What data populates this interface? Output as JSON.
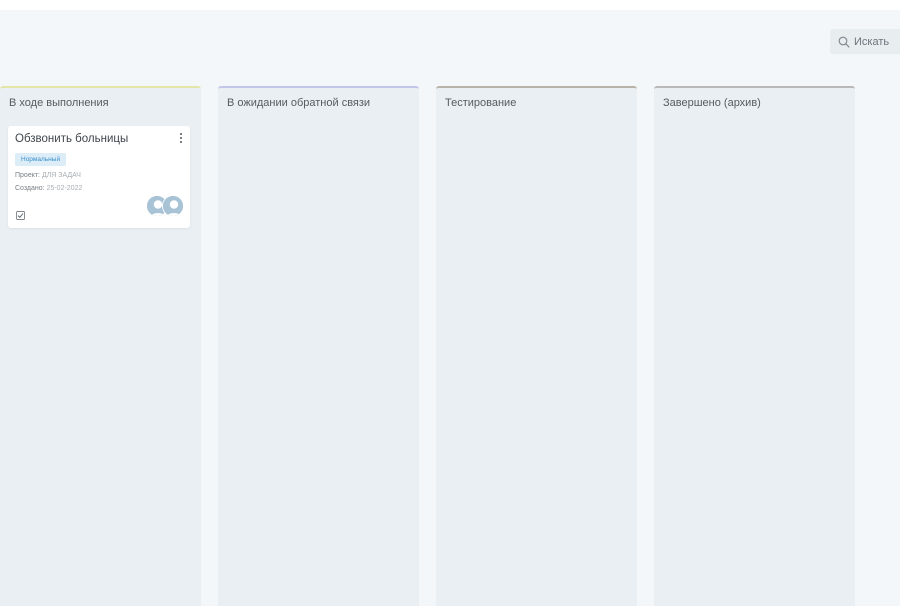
{
  "search": {
    "label": "Искать",
    "icon": "search-icon"
  },
  "columns": [
    {
      "title": "В ходе выполнения",
      "accent": "#e3e6a8",
      "cards": [
        {
          "title": "Обзвонить больницы",
          "priority": "Нормальный",
          "project_label": "Проект:",
          "project_value": "ДЛЯ ЗАДАЧ",
          "created_label": "Создано:",
          "created_value": "25-02-2022",
          "icons": [
            "checklist-icon",
            "more-vertical-icon"
          ],
          "avatars": 2
        }
      ]
    },
    {
      "title": "В ожидании обратной связи",
      "accent": "#c2c6e8",
      "cards": []
    },
    {
      "title": "Тестирование",
      "accent": "#b7b3a8",
      "cards": []
    },
    {
      "title": "Завершено (архив)",
      "accent": "#b9b9b9",
      "cards": []
    }
  ],
  "colors": {
    "background": "#f4f7f9",
    "column_background": "#e9eff2",
    "badge_background": "#dcedf8",
    "badge_text": "#3a8ec9",
    "avatar": "#a9c3d6"
  }
}
